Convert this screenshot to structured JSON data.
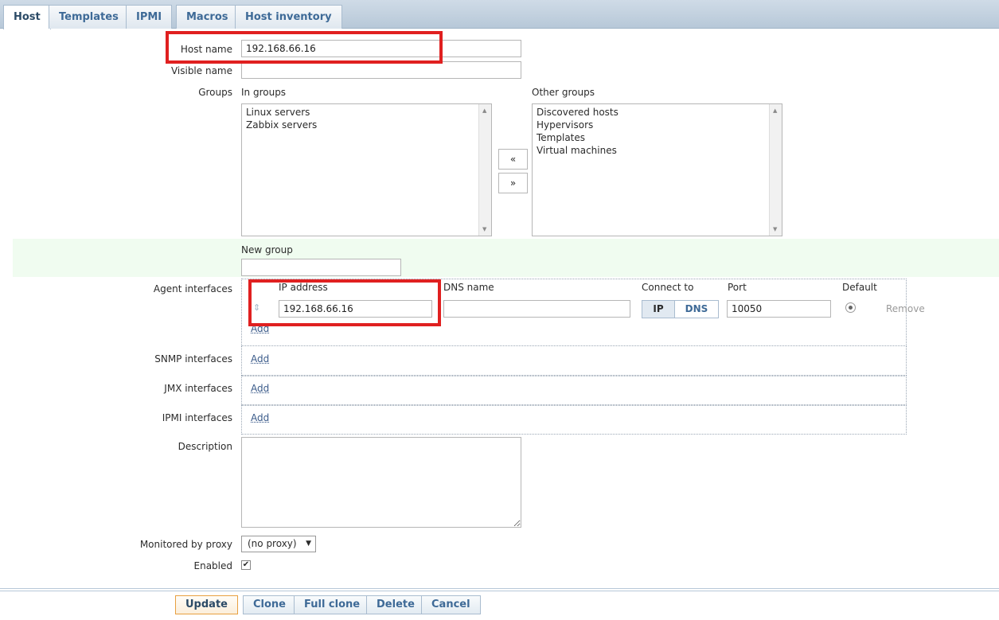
{
  "tabs": [
    {
      "label": "Host"
    },
    {
      "label": "Templates"
    },
    {
      "label": "IPMI"
    },
    {
      "label": "Macros"
    },
    {
      "label": "Host inventory"
    }
  ],
  "form": {
    "host_name_label": "Host name",
    "host_name_value": "192.168.66.16",
    "visible_name_label": "Visible name",
    "visible_name_value": "",
    "groups_label": "Groups",
    "in_groups_label": "In groups",
    "in_groups": [
      "Linux servers",
      "Zabbix servers"
    ],
    "other_groups_label": "Other groups",
    "other_groups": [
      "Discovered hosts",
      "Hypervisors",
      "Templates",
      "Virtual machines"
    ],
    "move_left": "«",
    "move_right": "»",
    "new_group_label": "New group",
    "new_group_value": "",
    "agent_interfaces_label": "Agent interfaces",
    "ip_address_header": "IP address",
    "dns_name_header": "DNS name",
    "connect_to_header": "Connect to",
    "port_header": "Port",
    "default_header": "Default",
    "agent_ip_value": "192.168.66.16",
    "agent_dns_value": "",
    "connect_ip": "IP",
    "connect_dns": "DNS",
    "agent_port_value": "10050",
    "remove_label": "Remove",
    "add_label": "Add",
    "snmp_interfaces_label": "SNMP interfaces",
    "jmx_interfaces_label": "JMX interfaces",
    "ipmi_interfaces_label": "IPMI interfaces",
    "description_label": "Description",
    "description_value": "",
    "monitored_by_proxy_label": "Monitored by proxy",
    "proxy_selected": "(no proxy)",
    "enabled_label": "Enabled",
    "enabled_checked": true
  },
  "footer": {
    "update": "Update",
    "clone": "Clone",
    "full_clone": "Full clone",
    "delete": "Delete",
    "cancel": "Cancel"
  },
  "colors": {
    "highlight_box": "#e02020",
    "tab_text": "#3e6a97",
    "new_group_row": "#f0fcf0"
  }
}
